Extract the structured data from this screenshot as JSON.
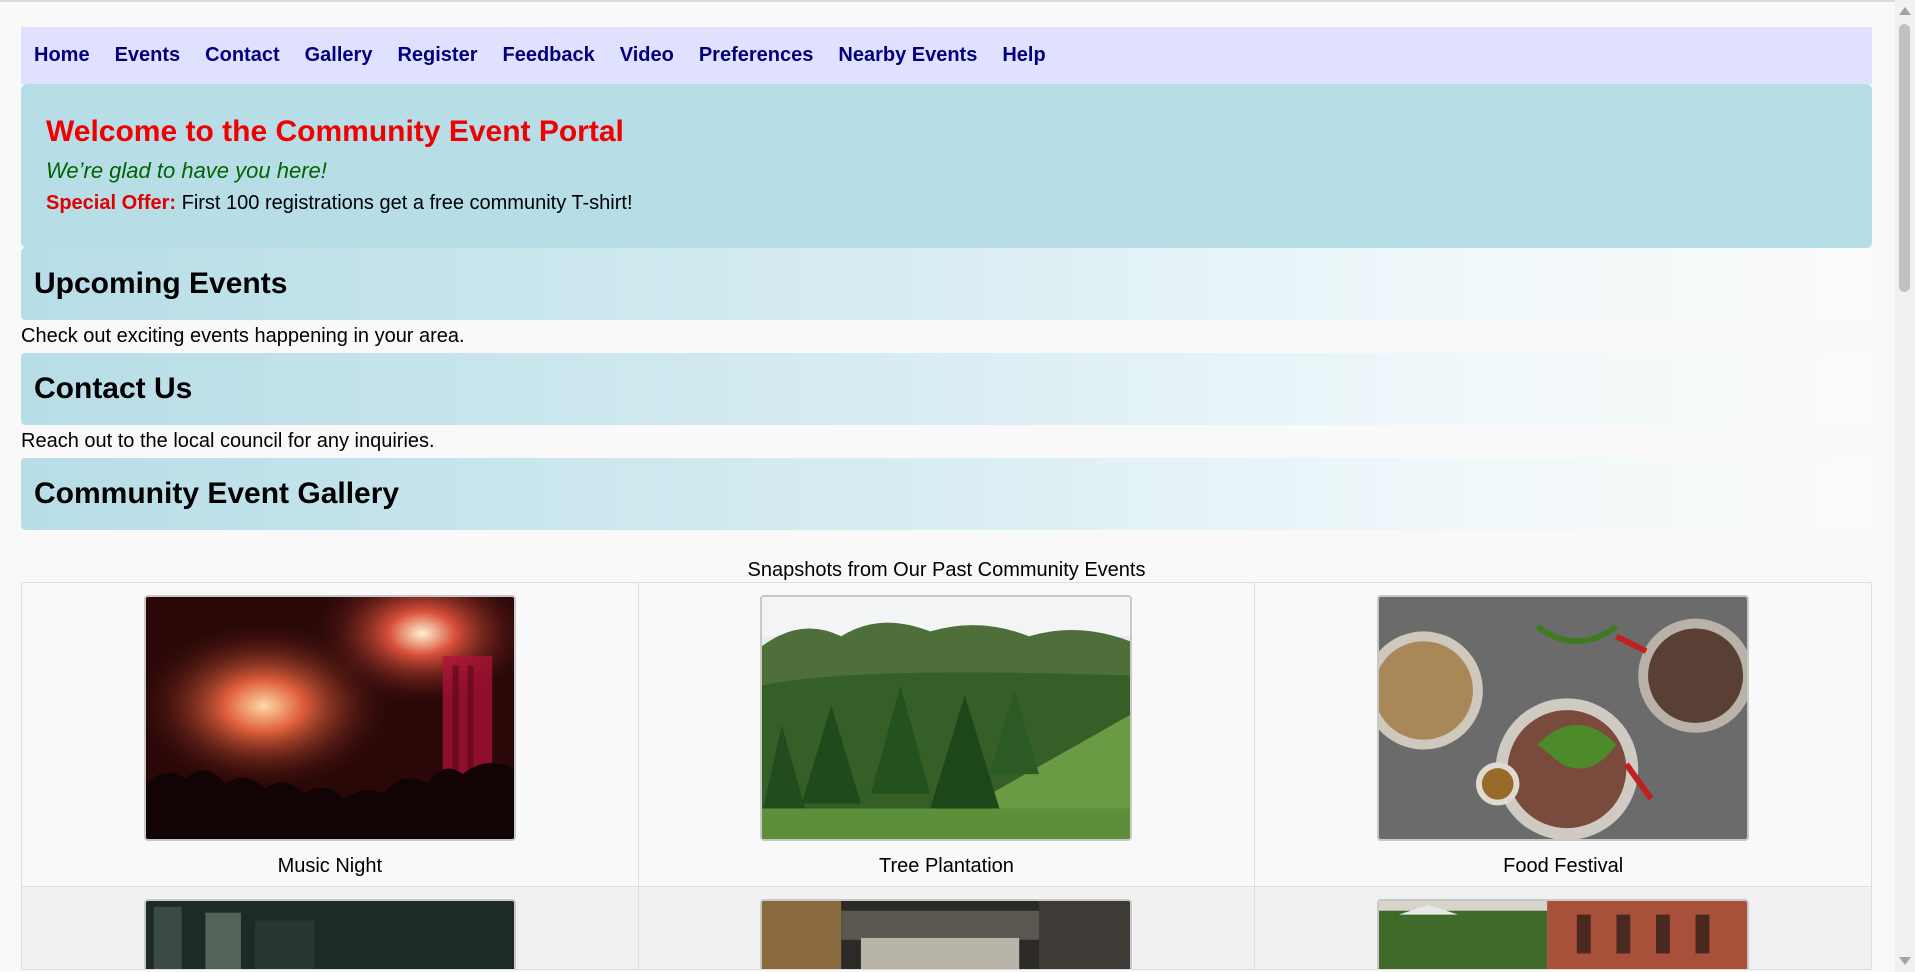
{
  "nav": [
    "Home",
    "Events",
    "Contact",
    "Gallery",
    "Register",
    "Feedback",
    "Video",
    "Preferences",
    "Nearby Events",
    "Help"
  ],
  "welcome": {
    "title": "Welcome to the Community Event Portal",
    "tagline": "We’re glad to have you here!",
    "offer_label": "Special Offer:",
    "offer_text": "First 100 registrations get a free community T-shirt!"
  },
  "sections": {
    "events": {
      "heading": "Upcoming Events",
      "text": "Check out exciting events happening in your area."
    },
    "contact": {
      "heading": "Contact Us",
      "text": "Reach out to the local council for any inquiries."
    },
    "gallery": {
      "heading": "Community Event Gallery"
    }
  },
  "gallery": {
    "caption": "Snapshots from Our Past Community Events",
    "items": [
      {
        "caption": "Music Night",
        "image": "concert-photo"
      },
      {
        "caption": "Tree Plantation",
        "image": "tree-field-photo"
      },
      {
        "caption": "Food Festival",
        "image": "food-plates-photo"
      }
    ]
  }
}
